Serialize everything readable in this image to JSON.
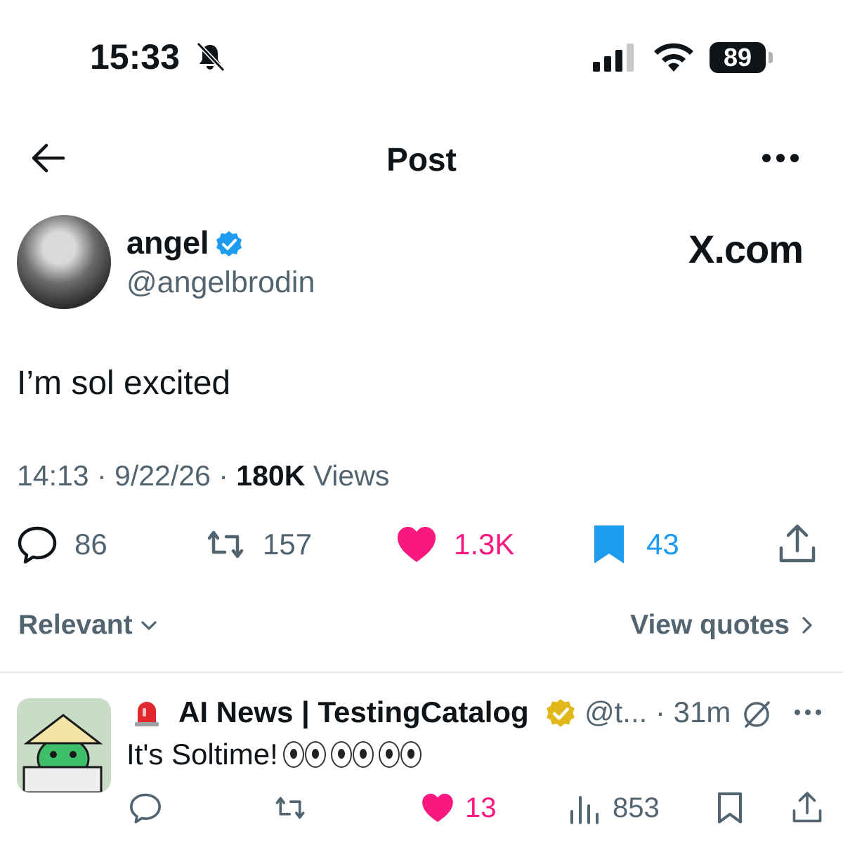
{
  "status_bar": {
    "time": "15:33",
    "battery": "89"
  },
  "header": {
    "title": "Post"
  },
  "post": {
    "author_name": "angel",
    "author_handle": "@angelbrodin",
    "brand": "X.com",
    "text": "I’m sol excited",
    "time": "14:13",
    "date": "9/22/26",
    "views_count": "180K",
    "views_label": "Views",
    "replies": "86",
    "reposts": "157",
    "likes": "1.3K",
    "bookmarks": "43"
  },
  "sort": {
    "label": "Relevant",
    "view_quotes": "View quotes"
  },
  "reply": {
    "name": "AI News | TestingCatalog",
    "handle_time": "@t... · 31m",
    "text": "It's Soltime!",
    "likes": "13",
    "views": "853"
  },
  "colors": {
    "like": "#f91880",
    "bookmark": "#1d9bf0",
    "secondary_text": "#536471",
    "verified_blue": "#1d9bf0",
    "verified_gold": "#e2b719"
  },
  "icons": [
    "bell-off-icon",
    "signal-icon",
    "wifi-icon",
    "battery-icon",
    "back-arrow-icon",
    "more-icon",
    "verified-badge-icon",
    "reply-icon",
    "repost-icon",
    "like-icon",
    "bookmark-icon",
    "share-icon",
    "chevron-down-icon",
    "chevron-right-icon",
    "siren-icon",
    "gold-verified-icon",
    "grok-icon",
    "views-icon"
  ]
}
